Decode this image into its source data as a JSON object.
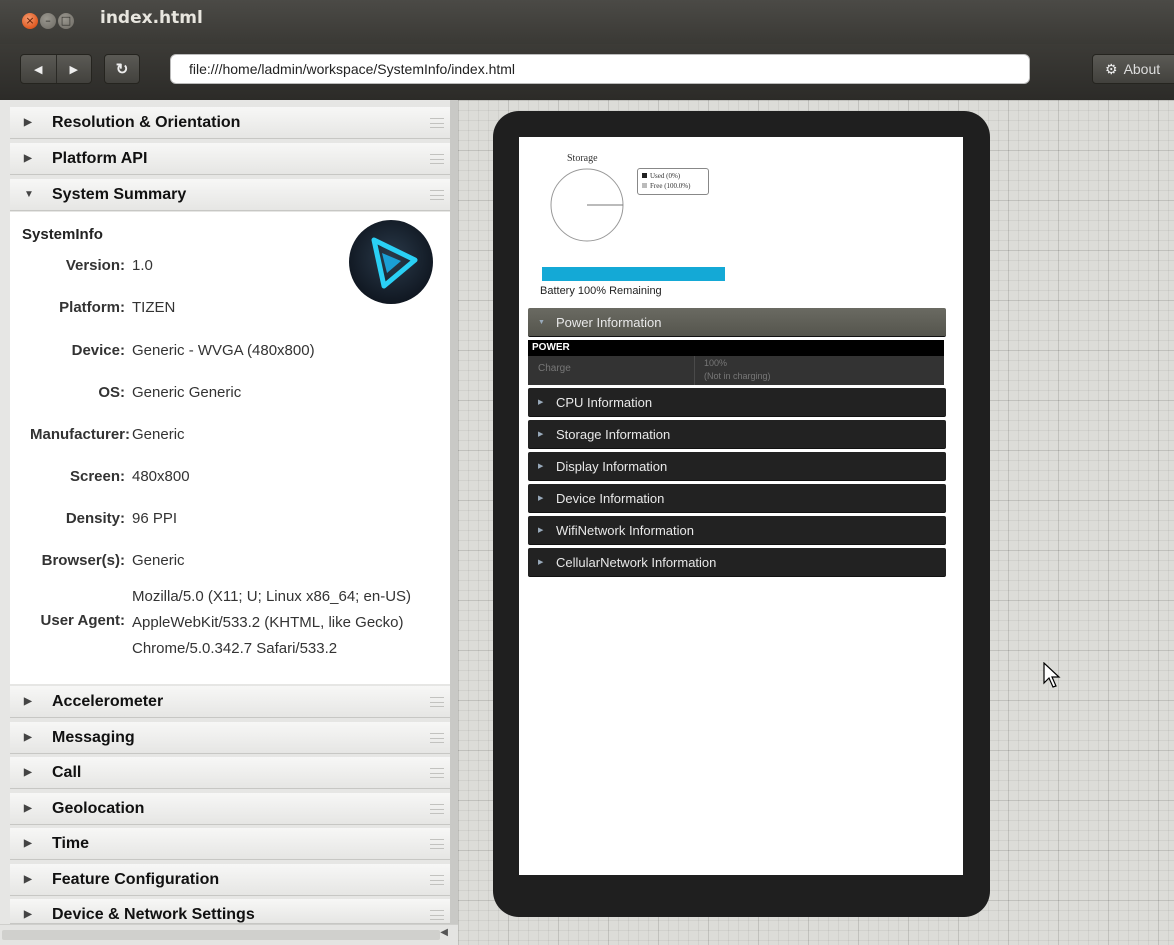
{
  "window": {
    "title": "index.html",
    "close_glyph": "×",
    "min_glyph": "–",
    "max_glyph": "□"
  },
  "toolbar": {
    "back_glyph": "◀",
    "forward_glyph": "▶",
    "reload_glyph": "↻",
    "url": "file:///home/ladmin/workspace/SystemInfo/index.html",
    "about_label": "About",
    "about_icon": "gear-icon"
  },
  "panels_top": [
    {
      "label": "Resolution & Orientation",
      "arrow": "▶"
    },
    {
      "label": "Platform API",
      "arrow": "▶"
    },
    {
      "label": "System Summary",
      "arrow": "▼"
    }
  ],
  "summary": {
    "heading": "SystemInfo",
    "rows": [
      {
        "key": "Version:",
        "value": "1.0"
      },
      {
        "key": "Platform:",
        "value": "TIZEN"
      },
      {
        "key": "Device:",
        "value": "Generic - WVGA (480x800)"
      },
      {
        "key": "OS:",
        "value": "Generic Generic"
      },
      {
        "key": "Manufacturer:",
        "value": "Generic"
      },
      {
        "key": "Screen:",
        "value": "480x800"
      },
      {
        "key": "Density:",
        "value": "96 PPI"
      },
      {
        "key": "Browser(s):",
        "value": "Generic"
      }
    ],
    "user_agent_key": "User Agent:",
    "user_agent_lines": [
      "Mozilla/5.0 (X11; U; Linux x86_64; en-US)",
      "AppleWebKit/533.2 (KHTML, like Gecko)",
      "Chrome/5.0.342.7 Safari/533.2"
    ]
  },
  "panels_bottom": [
    {
      "label": "Accelerometer",
      "arrow": "▶"
    },
    {
      "label": "Messaging",
      "arrow": "▶"
    },
    {
      "label": "Call",
      "arrow": "▶"
    },
    {
      "label": "Geolocation",
      "arrow": "▶"
    },
    {
      "label": "Time",
      "arrow": "▶"
    },
    {
      "label": "Feature Configuration",
      "arrow": "▶"
    },
    {
      "label": "Device & Network Settings",
      "arrow": "▶"
    }
  ],
  "device_app": {
    "storage_title": "Storage",
    "legend": [
      {
        "label": "Used (0%)",
        "color": "#222222"
      },
      {
        "label": "Free (100.0%)",
        "color": "#bbbbbb"
      }
    ],
    "storage_used_fraction": 0,
    "battery_fraction": 1.0,
    "battery_color": "#14a9d6",
    "battery_label": "Battery 100% Remaining",
    "power_section": "Power Information",
    "power_header": "POWER",
    "charge_label": "Charge",
    "charge_value_line1": "100%",
    "charge_value_line2": "(Not in charging)",
    "sections": [
      "CPU Information",
      "Storage Information",
      "Display Information",
      "Device Information",
      "WifiNetwork Information",
      "CellularNetwork Information"
    ]
  }
}
